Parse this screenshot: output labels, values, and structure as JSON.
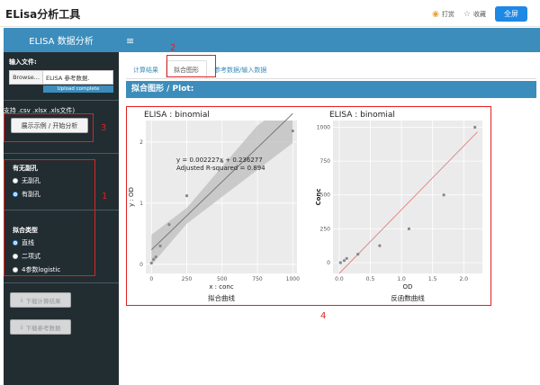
{
  "app": {
    "title": "ELisa分析工具",
    "reward_label": "打赏",
    "favorite_label": "收藏",
    "fullscreen_label": "全屏"
  },
  "sidebar": {
    "header": "ELISA 数据分析",
    "input_label": "输入文件:",
    "browse_label": "Browse...",
    "file_name": "ELISA 参考数据.",
    "upload_status": "Upload complete",
    "support_text": "(支持 .csv .xlsx .xls文件)",
    "demo_button": "展示示例 / 开始分析",
    "hole_group": {
      "label": "有无副孔",
      "options": [
        {
          "label": "无副孔",
          "checked": false
        },
        {
          "label": "有副孔",
          "checked": true
        }
      ]
    },
    "fit_group": {
      "label": "拟合类型",
      "options": [
        {
          "label": "直线",
          "checked": true
        },
        {
          "label": "二项式",
          "checked": false
        },
        {
          "label": "4参数logistic",
          "checked": false
        }
      ]
    },
    "download_results": "下载计算结果",
    "download_reference": "下载参考数据"
  },
  "main": {
    "tabs": [
      {
        "label": "计算结果",
        "active": false
      },
      {
        "label": "拟合图形",
        "active": true
      },
      {
        "label": "参考数据/输入数据",
        "active": false
      }
    ],
    "panel_title": "拟合图形 / Plot:"
  },
  "annotations": {
    "n1": "1",
    "n2": "2",
    "n3": "3",
    "n4": "4"
  },
  "colors": {
    "brand_blue": "#3c8dbc",
    "sidebar_dark": "#222d32",
    "annotation_red": "#e02020",
    "plot_bg": "#ebebeb"
  },
  "chart_data": [
    {
      "type": "scatter",
      "title": "ELISA : binomial",
      "xlabel": "x : conc",
      "ylabel": "y : OD",
      "caption": "拟合曲线",
      "xlim": [
        -40,
        1030
      ],
      "ylim": [
        -0.15,
        2.35
      ],
      "xticks": [
        "0",
        "250",
        "500",
        "750",
        "1000"
      ],
      "yticks": [
        "0",
        "1",
        "2"
      ],
      "points": [
        {
          "x": 0,
          "y": 0.02
        },
        {
          "x": 15,
          "y": 0.08
        },
        {
          "x": 31,
          "y": 0.12
        },
        {
          "x": 62,
          "y": 0.3
        },
        {
          "x": 125,
          "y": 0.65
        },
        {
          "x": 250,
          "y": 1.12
        },
        {
          "x": 500,
          "y": 1.68
        },
        {
          "x": 1000,
          "y": 2.18
        }
      ],
      "fit_line": {
        "slope": 0.002227,
        "intercept": 0.236277
      },
      "equation_text": "y = 0.002227x + 0.236277",
      "r2_text": "Adjusted R-squared = 0.894"
    },
    {
      "type": "scatter",
      "title": "ELISA : binomial",
      "xlabel": "OD",
      "ylabel": "Conc",
      "caption": "反函数曲线",
      "xlim": [
        -0.1,
        2.3
      ],
      "ylim": [
        -80,
        1050
      ],
      "xticks": [
        "0.0",
        "0.5",
        "1.0",
        "1.5",
        "2.0"
      ],
      "yticks": [
        "0",
        "250",
        "500",
        "750",
        "1000"
      ],
      "points": [
        {
          "x": 0.02,
          "y": 0
        },
        {
          "x": 0.08,
          "y": 15
        },
        {
          "x": 0.12,
          "y": 31
        },
        {
          "x": 0.3,
          "y": 62
        },
        {
          "x": 0.65,
          "y": 125
        },
        {
          "x": 1.12,
          "y": 250
        },
        {
          "x": 1.68,
          "y": 500
        },
        {
          "x": 2.18,
          "y": 1000
        }
      ]
    }
  ]
}
